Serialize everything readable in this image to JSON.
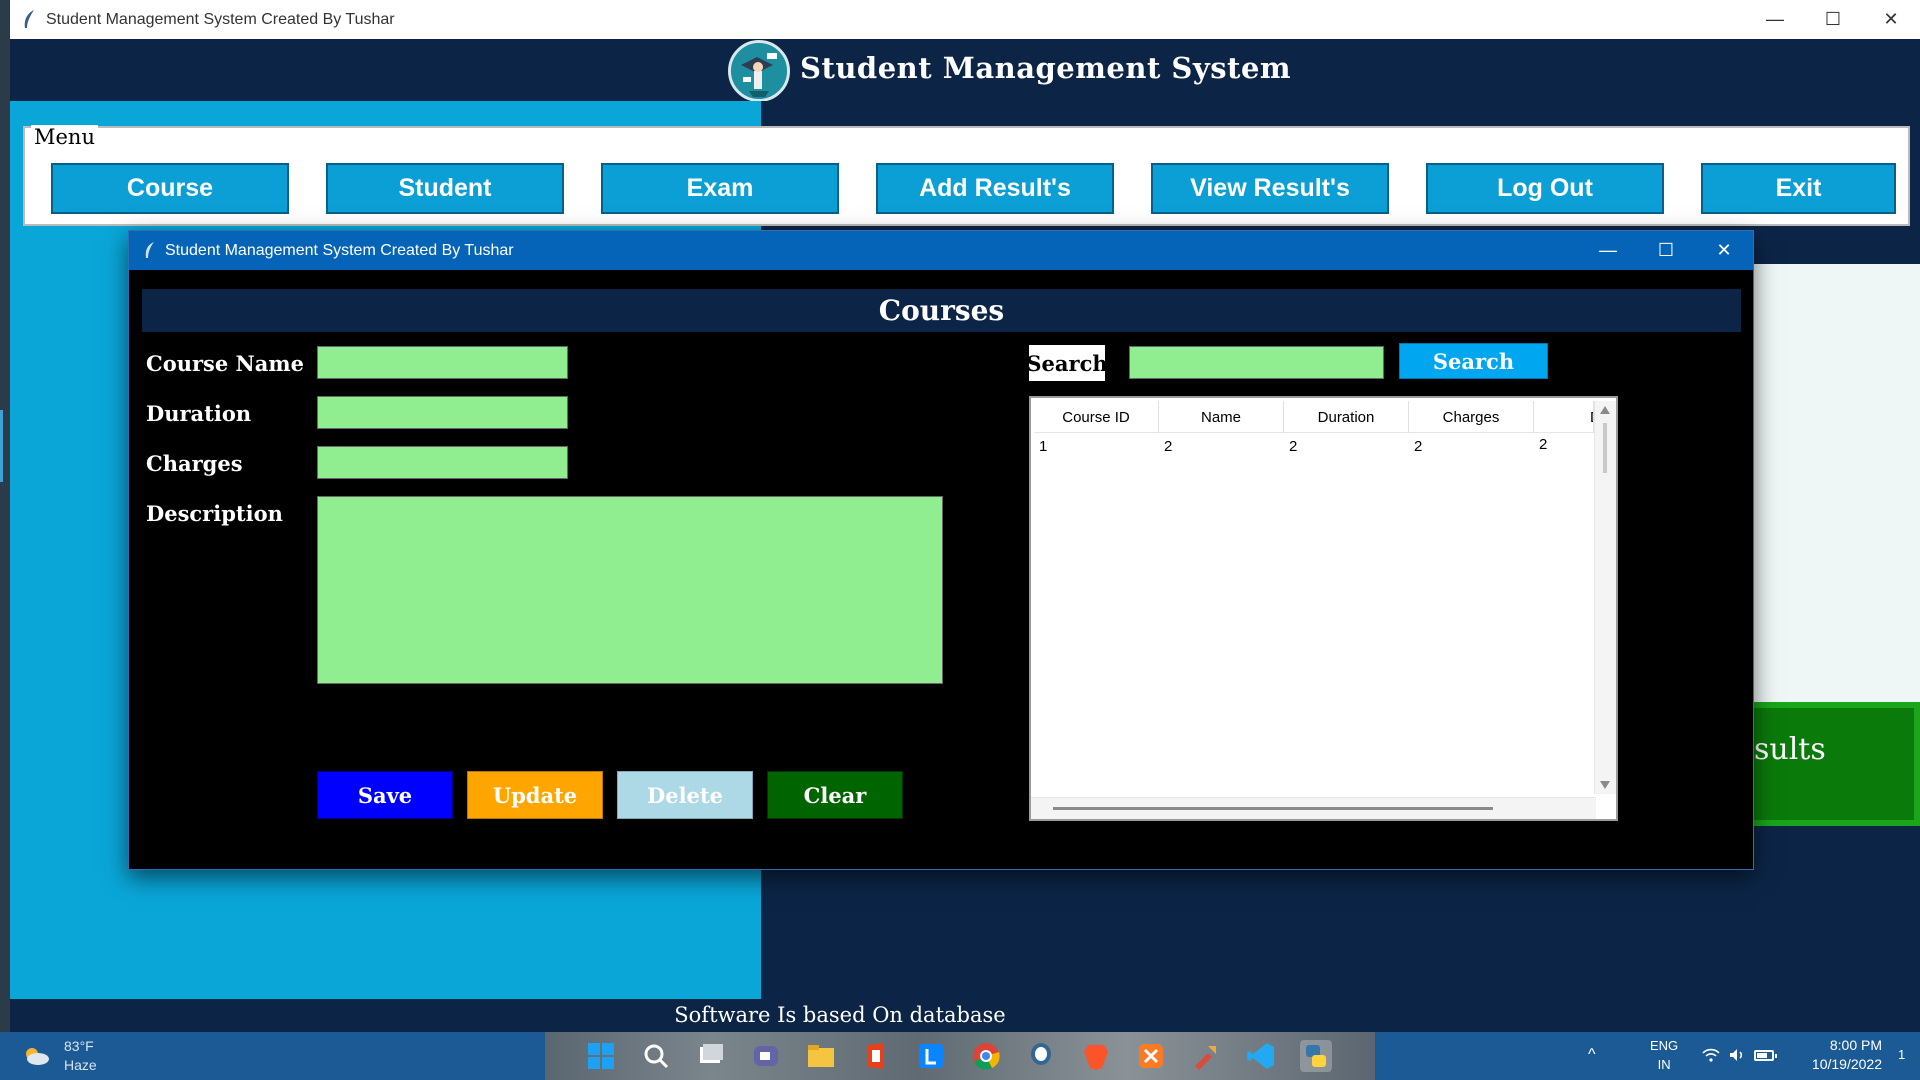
{
  "main_window": {
    "title": "Student Management System Created By Tushar",
    "controls": {
      "minimize": "—",
      "maximize": "☐",
      "close": "✕"
    }
  },
  "header": {
    "title": "Student Management System",
    "logo_icon": "graduation-logo-icon"
  },
  "menu": {
    "legend": "Menu",
    "buttons": [
      {
        "label": "Course"
      },
      {
        "label": "Student"
      },
      {
        "label": "Exam"
      },
      {
        "label": "Add Result's"
      },
      {
        "label": "View Result's"
      },
      {
        "label": "Log Out"
      },
      {
        "label": "Exit"
      }
    ]
  },
  "background_card": {
    "partial_text": "sults"
  },
  "footer": {
    "text": "Software Is based On database"
  },
  "dialog": {
    "title": "Student Management System Created By Tushar",
    "controls": {
      "minimize": "—",
      "maximize": "☐",
      "close": "✕"
    },
    "section_title": "Courses",
    "form": {
      "course_name_label": "Course Name",
      "duration_label": "Duration",
      "charges_label": "Charges",
      "description_label": "Description",
      "course_name_value": "",
      "duration_value": "",
      "charges_value": "",
      "description_value": ""
    },
    "actions": {
      "save": "Save",
      "update": "Update",
      "delete": "Delete",
      "clear": "Clear"
    },
    "search": {
      "label": "Search",
      "value": "",
      "button": "Search"
    },
    "table": {
      "columns": [
        "Course ID",
        "Name",
        "Duration",
        "Charges",
        "D"
      ],
      "rows": [
        [
          "1",
          "2",
          "2",
          "2",
          "2"
        ]
      ]
    }
  },
  "taskbar": {
    "weather_temp": "83°F",
    "weather_condition": "Haze",
    "tray_chevron": "^",
    "language": "ENG",
    "region": "IN",
    "time": "8:00 PM",
    "date": "10/19/2022",
    "notification_count": "1"
  },
  "colors": {
    "menu_button": "#0b9fd6",
    "input_fill": "#90ee90",
    "save": "#0000ff",
    "update": "#ffa500",
    "delete": "#add8e6",
    "clear": "#006400",
    "search_button": "#00a6ef",
    "header_bg": "#0c2547"
  }
}
